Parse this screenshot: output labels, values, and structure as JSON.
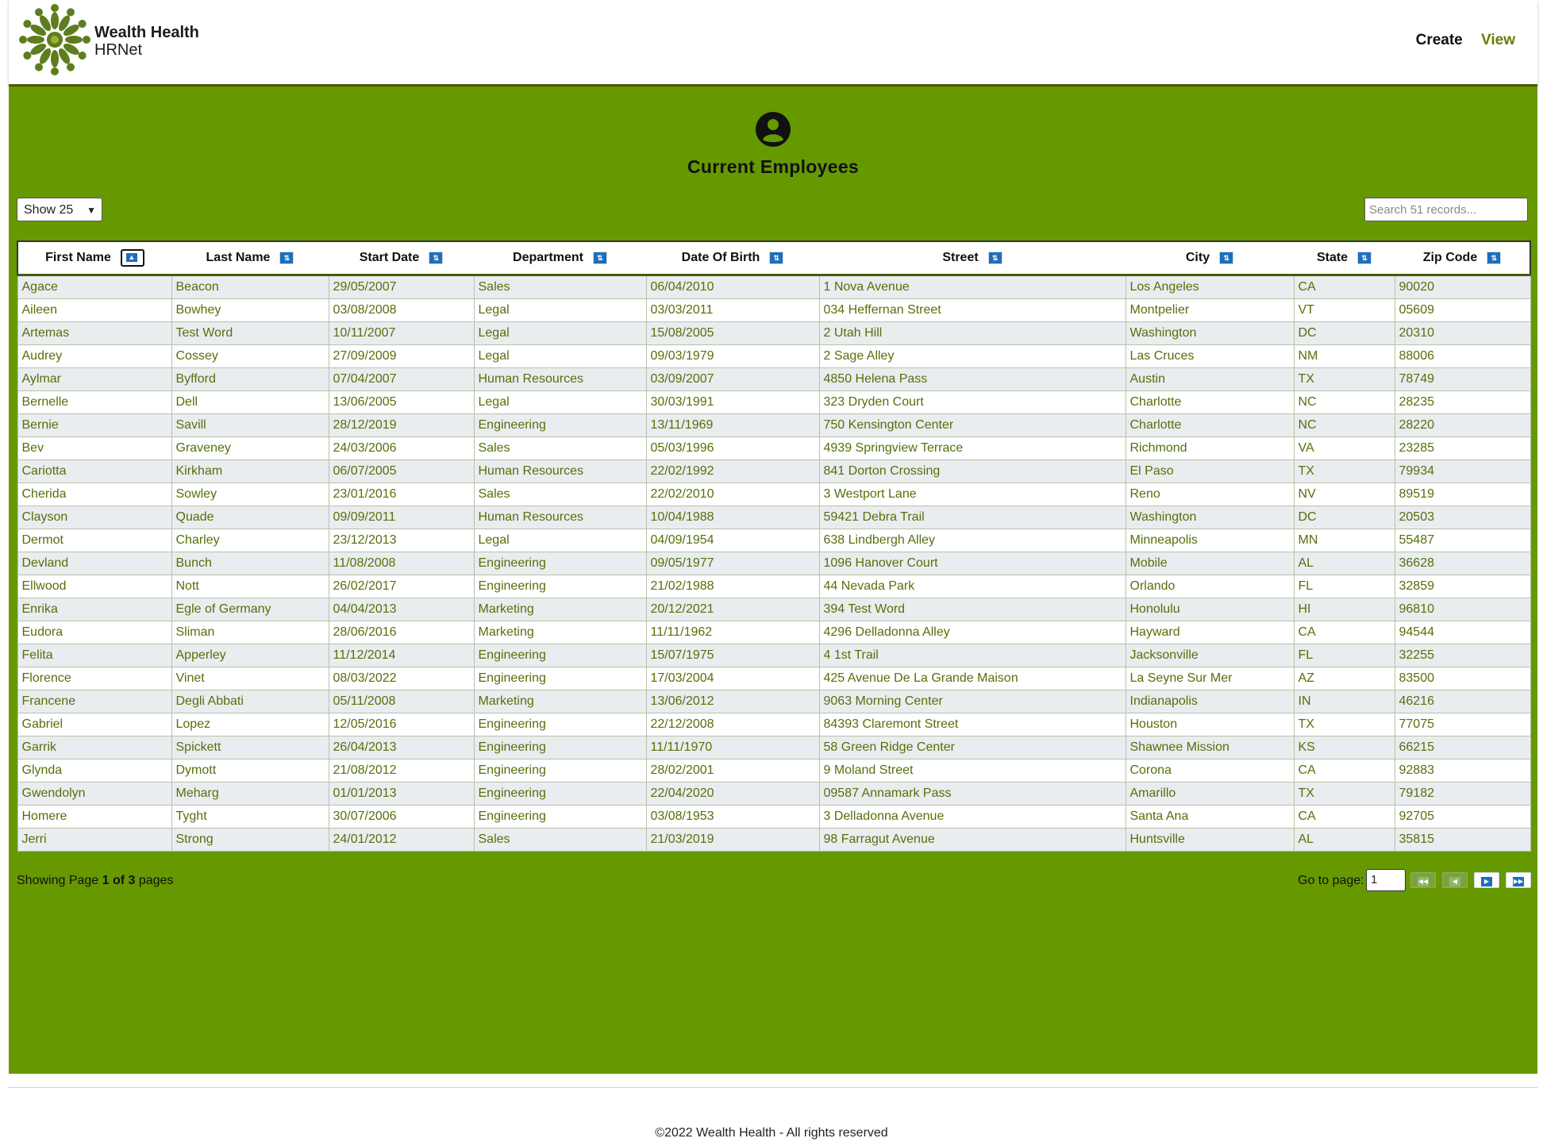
{
  "header": {
    "brand_name": "Wealth Health",
    "brand_sub": "HRNet",
    "nav": {
      "create": "Create",
      "view": "View"
    }
  },
  "main": {
    "title": "Current Employees",
    "show_entries": "Show 25",
    "search_placeholder": "Search 51 records...",
    "columns": [
      "First Name",
      "Last Name",
      "Start Date",
      "Department",
      "Date Of Birth",
      "Street",
      "City",
      "State",
      "Zip Code"
    ],
    "rows": [
      [
        "Agace",
        "Beacon",
        "29/05/2007",
        "Sales",
        "06/04/2010",
        "1 Nova Avenue",
        "Los Angeles",
        "CA",
        "90020"
      ],
      [
        "Aileen",
        "Bowhey",
        "03/08/2008",
        "Legal",
        "03/03/2011",
        "034 Heffernan Street",
        "Montpelier",
        "VT",
        "05609"
      ],
      [
        "Artemas",
        "Test Word",
        "10/11/2007",
        "Legal",
        "15/08/2005",
        "2 Utah Hill",
        "Washington",
        "DC",
        "20310"
      ],
      [
        "Audrey",
        "Cossey",
        "27/09/2009",
        "Legal",
        "09/03/1979",
        "2 Sage Alley",
        "Las Cruces",
        "NM",
        "88006"
      ],
      [
        "Aylmar",
        "Byfford",
        "07/04/2007",
        "Human Resources",
        "03/09/2007",
        "4850 Helena Pass",
        "Austin",
        "TX",
        "78749"
      ],
      [
        "Bernelle",
        "Dell",
        "13/06/2005",
        "Legal",
        "30/03/1991",
        "323 Dryden Court",
        "Charlotte",
        "NC",
        "28235"
      ],
      [
        "Bernie",
        "Savill",
        "28/12/2019",
        "Engineering",
        "13/11/1969",
        "750 Kensington Center",
        "Charlotte",
        "NC",
        "28220"
      ],
      [
        "Bev",
        "Graveney",
        "24/03/2006",
        "Sales",
        "05/03/1996",
        "4939 Springview Terrace",
        "Richmond",
        "VA",
        "23285"
      ],
      [
        "Cariotta",
        "Kirkham",
        "06/07/2005",
        "Human Resources",
        "22/02/1992",
        "841 Dorton Crossing",
        "El Paso",
        "TX",
        "79934"
      ],
      [
        "Cherida",
        "Sowley",
        "23/01/2016",
        "Sales",
        "22/02/2010",
        "3 Westport Lane",
        "Reno",
        "NV",
        "89519"
      ],
      [
        "Clayson",
        "Quade",
        "09/09/2011",
        "Human Resources",
        "10/04/1988",
        "59421 Debra Trail",
        "Washington",
        "DC",
        "20503"
      ],
      [
        "Dermot",
        "Charley",
        "23/12/2013",
        "Legal",
        "04/09/1954",
        "638 Lindbergh Alley",
        "Minneapolis",
        "MN",
        "55487"
      ],
      [
        "Devland",
        "Bunch",
        "11/08/2008",
        "Engineering",
        "09/05/1977",
        "1096 Hanover Court",
        "Mobile",
        "AL",
        "36628"
      ],
      [
        "Ellwood",
        "Nott",
        "26/02/2017",
        "Engineering",
        "21/02/1988",
        "44 Nevada Park",
        "Orlando",
        "FL",
        "32859"
      ],
      [
        "Enrika",
        "Egle of Germany",
        "04/04/2013",
        "Marketing",
        "20/12/2021",
        "394 Test Word",
        "Honolulu",
        "HI",
        "96810"
      ],
      [
        "Eudora",
        "Sliman",
        "28/06/2016",
        "Marketing",
        "11/11/1962",
        "4296 Delladonna Alley",
        "Hayward",
        "CA",
        "94544"
      ],
      [
        "Felita",
        "Apperley",
        "11/12/2014",
        "Engineering",
        "15/07/1975",
        "4 1st Trail",
        "Jacksonville",
        "FL",
        "32255"
      ],
      [
        "Florence",
        "Vinet",
        "08/03/2022",
        "Engineering",
        "17/03/2004",
        "425 Avenue De La Grande Maison",
        "La Seyne Sur Mer",
        "AZ",
        "83500"
      ],
      [
        "Francene",
        "Degli Abbati",
        "05/11/2008",
        "Marketing",
        "13/06/2012",
        "9063 Morning Center",
        "Indianapolis",
        "IN",
        "46216"
      ],
      [
        "Gabriel",
        "Lopez",
        "12/05/2016",
        "Engineering",
        "22/12/2008",
        "84393 Claremont Street",
        "Houston",
        "TX",
        "77075"
      ],
      [
        "Garrik",
        "Spickett",
        "26/04/2013",
        "Engineering",
        "11/11/1970",
        "58 Green Ridge Center",
        "Shawnee Mission",
        "KS",
        "66215"
      ],
      [
        "Glynda",
        "Dymott",
        "21/08/2012",
        "Engineering",
        "28/02/2001",
        "9 Moland Street",
        "Corona",
        "CA",
        "92883"
      ],
      [
        "Gwendolyn",
        "Meharg",
        "01/01/2013",
        "Engineering",
        "22/04/2020",
        "09587 Annamark Pass",
        "Amarillo",
        "TX",
        "79182"
      ],
      [
        "Homere",
        "Tyght",
        "30/07/2006",
        "Engineering",
        "03/08/1953",
        "3 Delladonna Avenue",
        "Santa Ana",
        "CA",
        "92705"
      ],
      [
        "Jerri",
        "Strong",
        "24/01/2012",
        "Sales",
        "21/03/2019",
        "98 Farragut Avenue",
        "Huntsville",
        "AL",
        "35815"
      ]
    ]
  },
  "pagination": {
    "showing_prefix": "Showing Page ",
    "page_bold": "1 of 3",
    "showing_suffix": " pages",
    "goto_label": "Go to page:",
    "page_value": "1"
  },
  "footer": {
    "text": "©2022 Wealth Health - All rights reserved"
  },
  "colors": {
    "accent": "#669900",
    "link": "#667f00",
    "sort_icon": "#1e6ebd"
  }
}
